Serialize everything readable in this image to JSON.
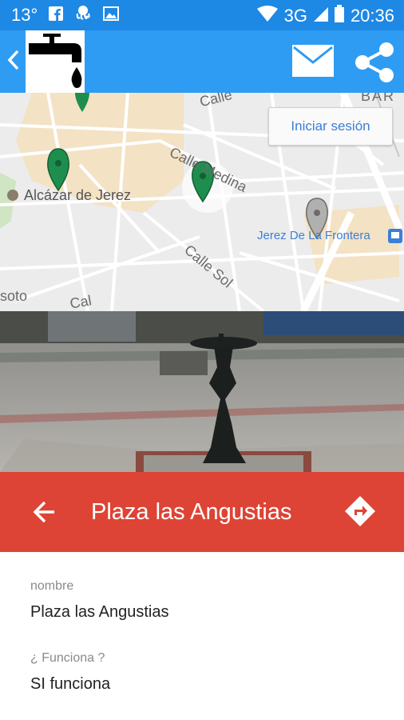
{
  "status_bar": {
    "temperature": "13°",
    "network": "3G",
    "time": "20:36",
    "icons": [
      "facebook-icon",
      "octopus-icon",
      "image-icon",
      "wifi-icon",
      "signal-icon",
      "battery-icon"
    ]
  },
  "app_bar": {
    "icons": [
      "back-chevron-icon",
      "water-tap-logo",
      "mail-icon",
      "share-icon"
    ],
    "color": "#2f9cf3"
  },
  "map": {
    "login_button": "Iniciar sesión",
    "labels": {
      "alcazar": "Alcázar de Jerez",
      "calle_medina": "Calle Medina",
      "calle_sol": "Calle Sol",
      "jerez_frontera": "Jerez De La Frontera",
      "soto": "soto",
      "calle_top": "Calle",
      "calle_bottom": "Cal",
      "bar": "BAR"
    },
    "pin_colors": {
      "active": "#1e8e4f",
      "inactive": "#b0b0b0"
    }
  },
  "header": {
    "title": "Plaza las Angustias",
    "color": "#dd4435"
  },
  "details": {
    "nombre_label": "nombre",
    "nombre_value": "Plaza las Angustias",
    "funciona_label": "¿ Funciona ?",
    "funciona_value": "SI funciona"
  }
}
